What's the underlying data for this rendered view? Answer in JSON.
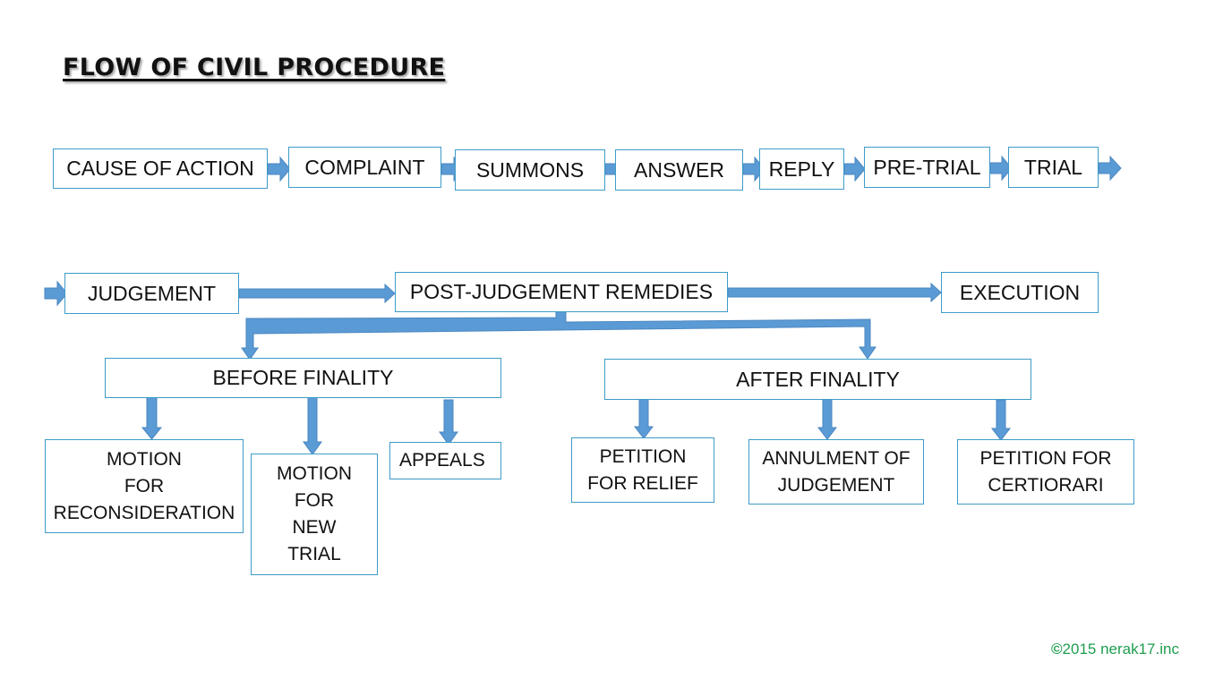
{
  "title": "FLOW OF CIVIL PROCEDURE",
  "colors": {
    "box_border": "#3d9bc8",
    "arrow_fill": "#5b9bd5",
    "arrow_stroke": "#4a86c0",
    "copyright": "#1f9e4f"
  },
  "main_flow": [
    "CAUSE OF ACTION",
    "COMPLAINT",
    "SUMMONS",
    "ANSWER",
    "REPLY",
    "PRE-TRIAL",
    "TRIAL"
  ],
  "second_row": {
    "judgement": "JUDGEMENT",
    "post_judgement": "POST-JUDGEMENT REMEDIES",
    "execution": "EXECUTION"
  },
  "branches": {
    "before_finality": {
      "label": "BEFORE FINALITY",
      "children": [
        "MOTION\nFOR\nRECONSIDERATION",
        "MOTION\nFOR\nNEW\nTRIAL",
        "APPEALS"
      ]
    },
    "after_finality": {
      "label": "AFTER FINALITY",
      "children": [
        "PETITION\nFOR RELIEF",
        "ANNULMENT OF\nJUDGEMENT",
        "PETITION FOR\nCERTIORARI"
      ]
    }
  },
  "copyright": {
    "symbol": "©",
    "text": "2015 nerak17.inc"
  }
}
